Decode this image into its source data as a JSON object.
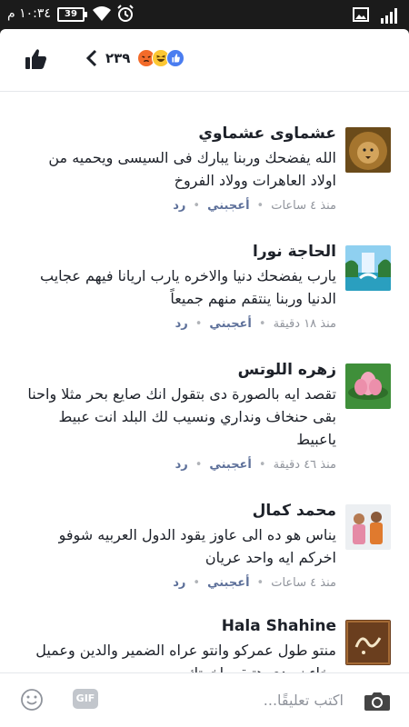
{
  "status_bar": {
    "time": "١٠:٣٤ م",
    "battery": "39"
  },
  "header": {
    "reaction_count": "٢٣٩",
    "reactions": [
      "angry-icon",
      "haha-icon",
      "like-icon"
    ]
  },
  "comments": [
    {
      "author": "عشماوى عشماوي",
      "text": "الله يفضحك وربنا يبارك فى السيسى ويحميه من اولاد العاهرات وولاد الفروخ",
      "time": "منذ ٤ ساعات",
      "like_label": "أعجبني",
      "reply_label": "رد",
      "avatar": "lion"
    },
    {
      "author": "الحاجة نورا",
      "text": "يارب يفضحك دنيا والاخره يارب اريانا فيهم عجايب الدنيا وربنا ينتقم منهم جميعاً",
      "time": "منذ ١٨ دقيقة",
      "like_label": "أعجبني",
      "reply_label": "رد",
      "avatar": "landscape"
    },
    {
      "author": "زهره اللوتس",
      "text": "تقصد ايه بالصورة دى بتقول انك صايع بحر مثلا واحنا بقى حنخاف ونداري ونسيب لك البلد انت عبيط ياعبيط",
      "time": "منذ ٤٦ دقيقة",
      "like_label": "أعجبني",
      "reply_label": "رد",
      "avatar": "lotus"
    },
    {
      "author": "محمد كمال",
      "text": "يناس هو ده الى عاوز يقود الدول العربيه شوفو اخركم ايه واحد عريان",
      "time": "منذ ٤ ساعات",
      "like_label": "أعجبني",
      "reply_label": "رد",
      "avatar": "people"
    },
    {
      "author": "Hala Shahine",
      "text": "منتو طول عمركو وانتو عراه الضمير والدين وعميل وخاءن ودى هتبقى اخرتك",
      "time": "",
      "like_label": "",
      "reply_label": "",
      "avatar": "calligraphy"
    }
  ],
  "composer": {
    "placeholder": "اكتب تعليقًا...",
    "gif_label": "GIF"
  }
}
